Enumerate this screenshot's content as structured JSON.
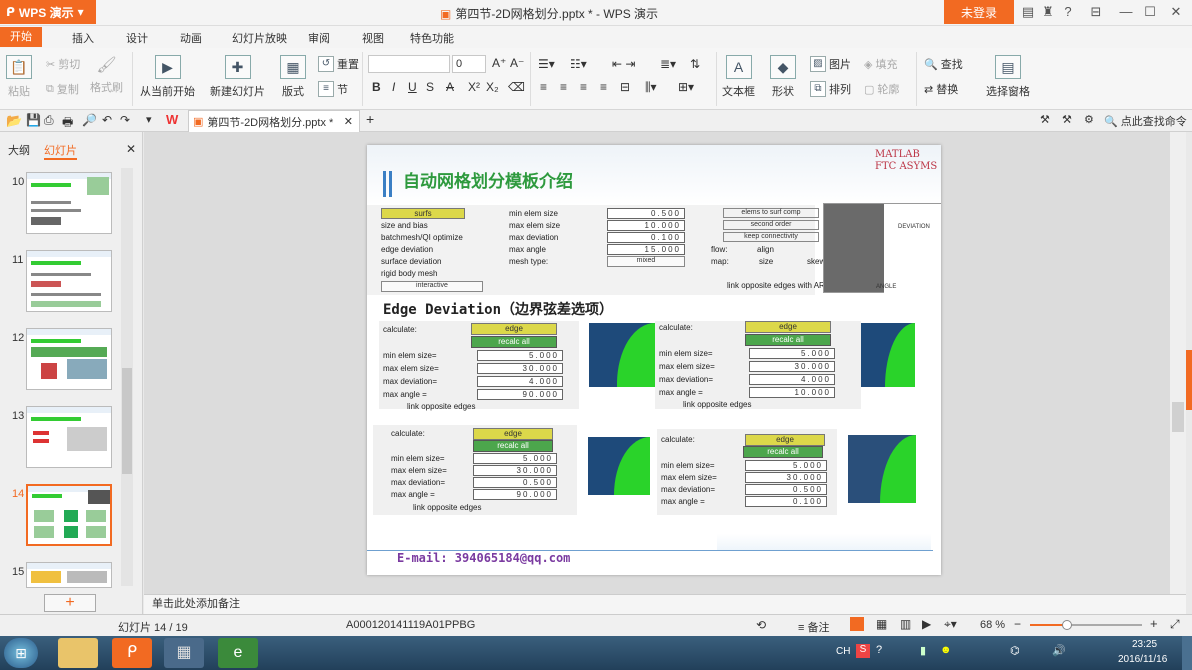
{
  "app": {
    "name": "WPS 演示",
    "doc_title": "第四节-2D网格划分.pptx * - WPS 演示",
    "login": "未登录"
  },
  "menu": [
    "开始",
    "插入",
    "设计",
    "动画",
    "幻灯片放映",
    "审阅",
    "视图",
    "特色功能"
  ],
  "ribbon": {
    "paste": "粘贴",
    "cut": "剪切",
    "copy": "复制",
    "format_painter": "格式刷",
    "from_current": "从当前开始",
    "new_slide": "新建幻灯片",
    "layout": "版式",
    "reset": "重置",
    "section": "节",
    "font_size": "0",
    "textbox": "文本框",
    "shape": "形状",
    "picture": "图片",
    "arrange": "排列",
    "fill": "填充",
    "outline": "轮廓",
    "find": "查找",
    "replace": "替换",
    "select_pane": "选择窗格"
  },
  "quick": {
    "doc_tab": "第四节-2D网格划分.pptx *",
    "search_cmd": "点此查找命令"
  },
  "panel": {
    "tab_outline": "大纲",
    "tab_slides": "幻灯片",
    "slides": [
      "10",
      "11",
      "12",
      "13",
      "14",
      "15"
    ],
    "current": "14"
  },
  "notes_placeholder": "单击此处添加备注",
  "status": {
    "slide_pos": "幻灯片 14 / 19",
    "code": "A000120141119A01PPBG",
    "notes": "备注",
    "zoom": "68 %"
  },
  "clock": {
    "time": "23:25",
    "date": "2016/11/16"
  },
  "tray": {
    "lang": "CH"
  },
  "slide": {
    "title": "自动网格划分模板介绍",
    "logo": "MATLAB FTC ASYMS",
    "section_title": "Edge Deviation（边界弦差选项）",
    "email": "E-mail: 394065184@qq.com",
    "top_panel": {
      "surfs": "surfs",
      "opts": [
        "size and bias",
        "batchmesh/QI optimize",
        "edge deviation",
        "surface deviation",
        "rigid body mesh"
      ],
      "interactive": "interactive",
      "fields": [
        {
          "label": "min elem size",
          "value": "0.500"
        },
        {
          "label": "max elem size",
          "value": "10.000"
        },
        {
          "label": "max deviation",
          "value": "0.100"
        },
        {
          "label": "max angle",
          "value": "15.000"
        }
      ],
      "mesh_type_label": "mesh type:",
      "mesh_type": "mixed",
      "btns": [
        "elems to surf comp",
        "second order",
        "keep connectivity"
      ],
      "flow": "flow:",
      "align": "align",
      "map": "map:",
      "size": "size",
      "skew": "skew",
      "link": "link opposite edges with AR",
      "deviation": "DEVIATION",
      "angle": "ANGLE"
    },
    "panels": [
      {
        "edge": "edge",
        "recalc": "recalc all",
        "values": [
          "5.000",
          "30.000",
          "4.000",
          "90.000"
        ]
      },
      {
        "edge": "edge",
        "recalc": "recalc all",
        "values": [
          "5.000",
          "30.000",
          "4.000",
          "10.000"
        ]
      },
      {
        "edge": "edge",
        "recalc": "recalc all",
        "values": [
          "5.000",
          "30.000",
          "0.500",
          "90.000"
        ]
      },
      {
        "edge": "edge",
        "recalc": "recalc all",
        "values": [
          "5.000",
          "30.000",
          "0.500",
          "0.100"
        ]
      }
    ],
    "labels": {
      "calculate": "calculate:",
      "min": "min elem size=",
      "max": "max elem size=",
      "dev": "max deviation=",
      "ang": "max angle  =",
      "link": "link opposite edges"
    }
  }
}
